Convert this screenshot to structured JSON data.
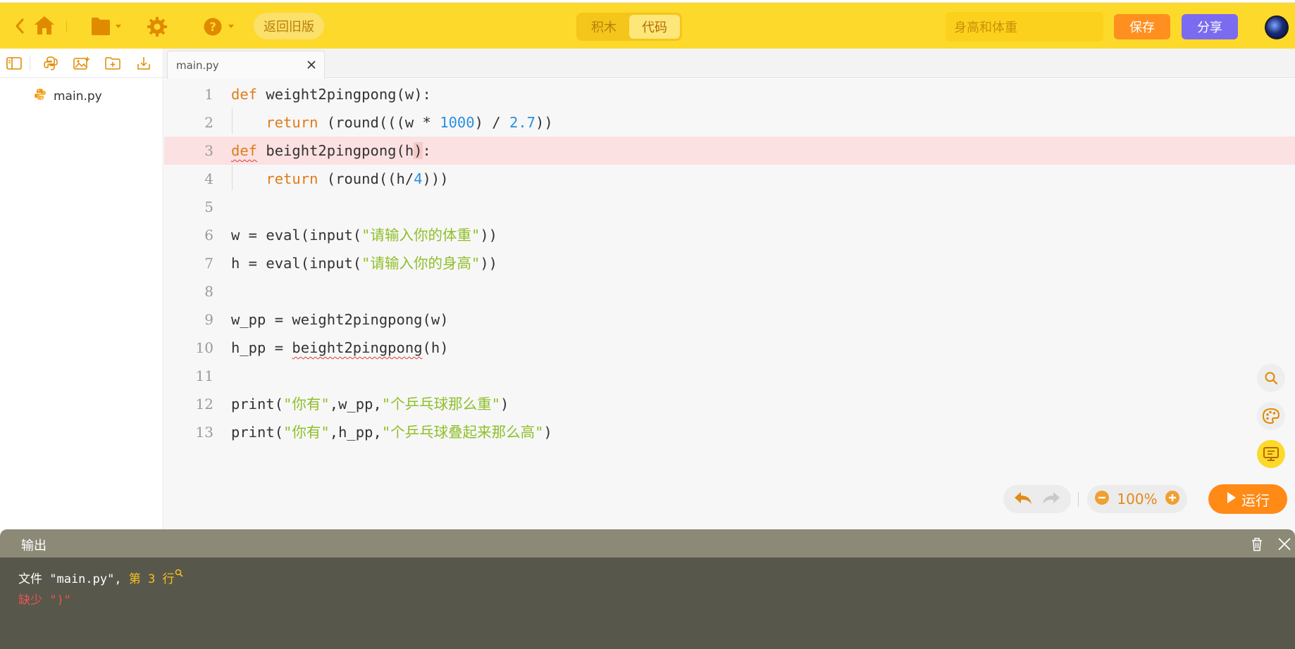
{
  "header": {
    "old_version_label": "返回旧版",
    "mode_blocks": "积木",
    "mode_code": "代码",
    "project_name": "身高和体重",
    "save_label": "保存",
    "share_label": "分享",
    "accent_color": "#fdd92b"
  },
  "sidebar": {
    "files": [
      {
        "name": "main.py"
      }
    ]
  },
  "tabs": [
    {
      "label": "main.py"
    }
  ],
  "editor": {
    "line_numbers": [
      "1",
      "2",
      "3",
      "4",
      "5",
      "6",
      "7",
      "8",
      "9",
      "10",
      "11",
      "12",
      "13"
    ],
    "error_line": 3
  },
  "toolbar": {
    "zoom": "100%",
    "run_label": "运行"
  },
  "output": {
    "title": "输出",
    "error_file_text": "文件 \"main.py\", ",
    "error_link_text": "第 3 行",
    "error_message": "缺少 \")\""
  }
}
